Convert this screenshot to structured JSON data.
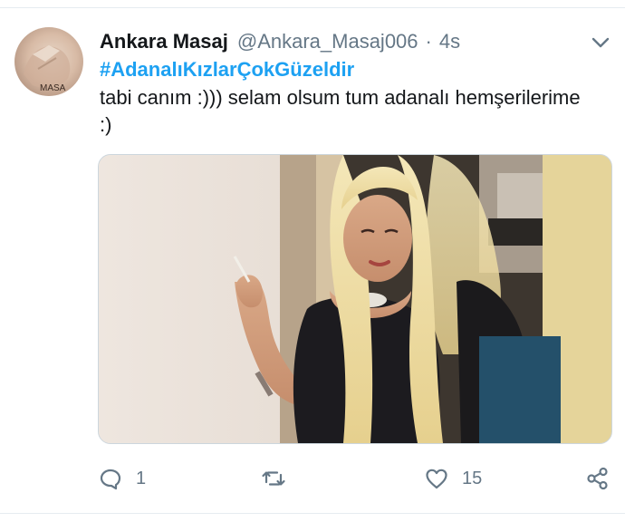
{
  "tweet": {
    "display_name": "Ankara Masaj",
    "handle": "@Ankara_Masaj006",
    "separator": "·",
    "time": "4s",
    "hashtag": "#AdanalıKızlarÇokGüzeldir",
    "text": "tabi canım :))) selam olsum tum adanalı hemşerilerime :)",
    "avatar_text": "MASA",
    "menu_icon": "chevron-down-icon"
  },
  "actions": {
    "reply": {
      "icon": "reply-icon",
      "count": "1"
    },
    "retweet": {
      "icon": "retweet-icon",
      "count": ""
    },
    "like": {
      "icon": "heart-icon",
      "count": "15"
    },
    "share": {
      "icon": "share-icon",
      "count": ""
    }
  },
  "colors": {
    "accent": "#1da1f2",
    "secondary_text": "#657786",
    "primary_text": "#14171a",
    "divider": "#e6ecf0"
  }
}
